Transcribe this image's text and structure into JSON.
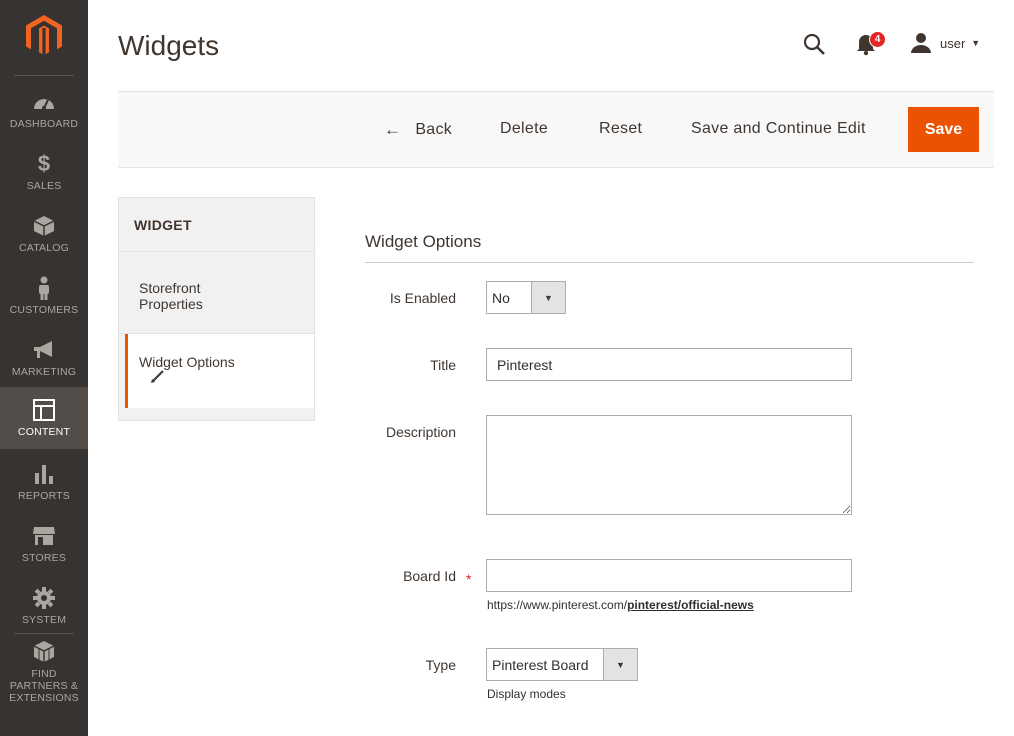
{
  "header": {
    "title": "Widgets",
    "notifications_count": "4",
    "user_name": "user",
    "user_caret": "▼"
  },
  "sidebar": {
    "items": [
      {
        "label": "DASHBOARD",
        "icon": "dashboard-icon"
      },
      {
        "label": "SALES",
        "icon": "dollar-icon"
      },
      {
        "label": "CATALOG",
        "icon": "box-icon"
      },
      {
        "label": "CUSTOMERS",
        "icon": "person-icon"
      },
      {
        "label": "MARKETING",
        "icon": "megaphone-icon"
      },
      {
        "label": "CONTENT",
        "icon": "layout-icon",
        "active": true
      },
      {
        "label": "REPORTS",
        "icon": "bar-chart-icon"
      },
      {
        "label": "STORES",
        "icon": "store-icon"
      },
      {
        "label": "SYSTEM",
        "icon": "gear-icon"
      },
      {
        "label": "FIND PARTNERS & EXTENSIONS",
        "icon": "cubes-icon"
      }
    ]
  },
  "actions": {
    "back_arrow": "←",
    "back": "Back",
    "delete": "Delete",
    "reset": "Reset",
    "save_continue": "Save and Continue Edit",
    "save": "Save"
  },
  "tabs": {
    "heading": "WIDGET",
    "items": [
      {
        "label": "Storefront Properties"
      },
      {
        "label": "Widget Options",
        "active": true
      }
    ]
  },
  "form": {
    "section_title": "Widget Options",
    "is_enabled": {
      "label": "Is Enabled",
      "value": "No",
      "arrow": "▼"
    },
    "title": {
      "label": "Title",
      "value": "Pinterest"
    },
    "description": {
      "label": "Description",
      "value": ""
    },
    "board_id": {
      "label": "Board Id",
      "required_mark": "*",
      "value": "",
      "note_prefix": "https://www.pinterest.com/",
      "note_bold": "pinterest/official-news"
    },
    "type": {
      "label": "Type",
      "value": "Pinterest Board",
      "arrow": "▼",
      "note": "Display modes"
    }
  },
  "colors": {
    "accent": "#eb5202",
    "sidebar_bg": "#373330",
    "sidebar_active": "#524d49",
    "badge": "#e22626"
  }
}
